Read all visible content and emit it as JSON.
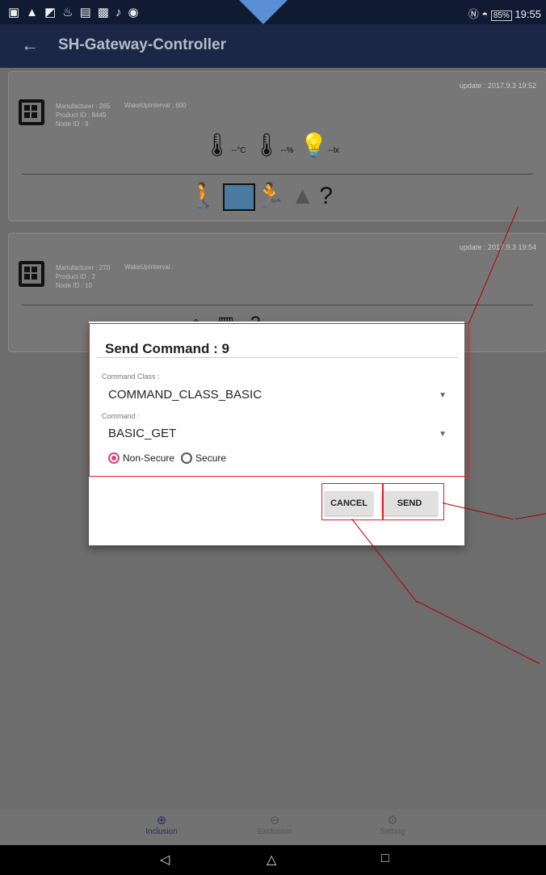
{
  "status_bar": {
    "time": "19:55",
    "battery": "85%"
  },
  "app_bar": {
    "title": "SH-Gateway-Controller"
  },
  "cards": [
    {
      "update": "update : 2017.9.3 19:52",
      "manufacturer": "Manufacturer : 265",
      "product_id": "Product ID : 8449",
      "node_id": "Node ID : 9",
      "wake_interval": "WakeUpInterval : 600",
      "sensors": {
        "temp": "--",
        "temp_unit": "°C",
        "hum": "--",
        "hum_unit": "%",
        "lux": "--",
        "lux_unit": "lx"
      }
    },
    {
      "update": "update : 2017.9.3 19:54",
      "manufacturer": "Manufacturer : 270",
      "product_id": "Product ID : 2",
      "node_id": "Node ID : 10",
      "wake_interval": "WakeUpInterval :"
    }
  ],
  "dialog": {
    "title": "Send Command : 9",
    "command_class_label": "Command Class :",
    "command_class_value": "COMMAND_CLASS_BASIC",
    "command_label": "Command :",
    "command_value": "BASIC_GET",
    "radio_nonsecure": "Non-Secure",
    "radio_secure": "Secure",
    "selected_security": "Non-Secure",
    "cancel_label": "CANCEL",
    "send_label": "SEND"
  },
  "bottom_nav": [
    {
      "label": "Inclusion",
      "icon": "plus-circle-icon"
    },
    {
      "label": "Exclusion",
      "icon": "minus-circle-icon"
    },
    {
      "label": "Setting",
      "icon": "gear-icon"
    }
  ],
  "colors": {
    "app_bar": "#1c2747",
    "accent": "#e0407f",
    "annotation": "#e02020"
  }
}
